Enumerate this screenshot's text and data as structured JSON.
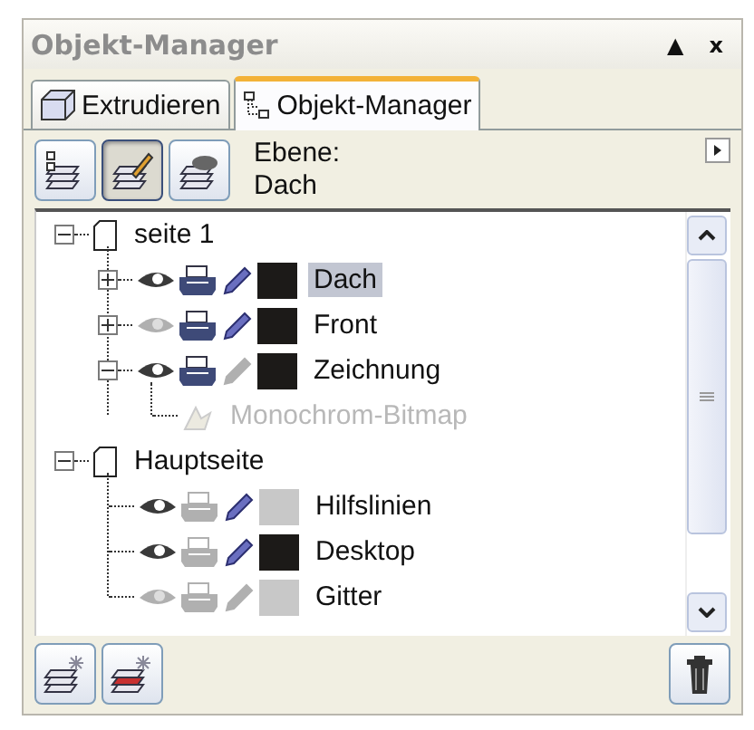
{
  "window": {
    "title": "Objekt-Manager",
    "controls": [
      "▲",
      "x"
    ]
  },
  "tabs": [
    {
      "label": "Extrudieren",
      "selected": false
    },
    {
      "label": "Objekt-Manager",
      "selected": true
    }
  ],
  "toolbar": {
    "buttons": [
      {
        "selected": false
      },
      {
        "selected": true
      },
      {
        "selected": false
      }
    ],
    "layer_label": "Ebene:",
    "layer_name": "Dach"
  },
  "tree": [
    {
      "kind": "page",
      "label": "seite 1",
      "expanded": true,
      "children": [
        {
          "kind": "layer",
          "label": "Dach",
          "expanded": false,
          "visible": true,
          "printable": true,
          "editable": true,
          "color": "#1c1a18",
          "selected": true
        },
        {
          "kind": "layer",
          "label": "Front",
          "expanded": false,
          "visible": false,
          "printable": true,
          "editable": true,
          "color": "#1c1a18",
          "selected": false
        },
        {
          "kind": "layer",
          "label": "Zeichnung",
          "expanded": true,
          "visible": true,
          "printable": true,
          "editable": false,
          "color": "#1c1a18",
          "selected": false,
          "children": [
            {
              "kind": "object",
              "label": "Monochrom-Bitmap",
              "disabled": true
            }
          ]
        }
      ]
    },
    {
      "kind": "page",
      "label": "Hauptseite",
      "expanded": true,
      "children": [
        {
          "kind": "layer",
          "label": "Hilfslinien",
          "visible": true,
          "printable": false,
          "editable": true,
          "color": "#c8c8c8",
          "selected": false
        },
        {
          "kind": "layer",
          "label": "Desktop",
          "visible": true,
          "printable": false,
          "editable": true,
          "color": "#1c1a18",
          "selected": false
        },
        {
          "kind": "layer",
          "label": "Gitter",
          "visible": false,
          "printable": false,
          "editable": false,
          "color": "#c8c8c8",
          "selected": false
        }
      ]
    }
  ]
}
